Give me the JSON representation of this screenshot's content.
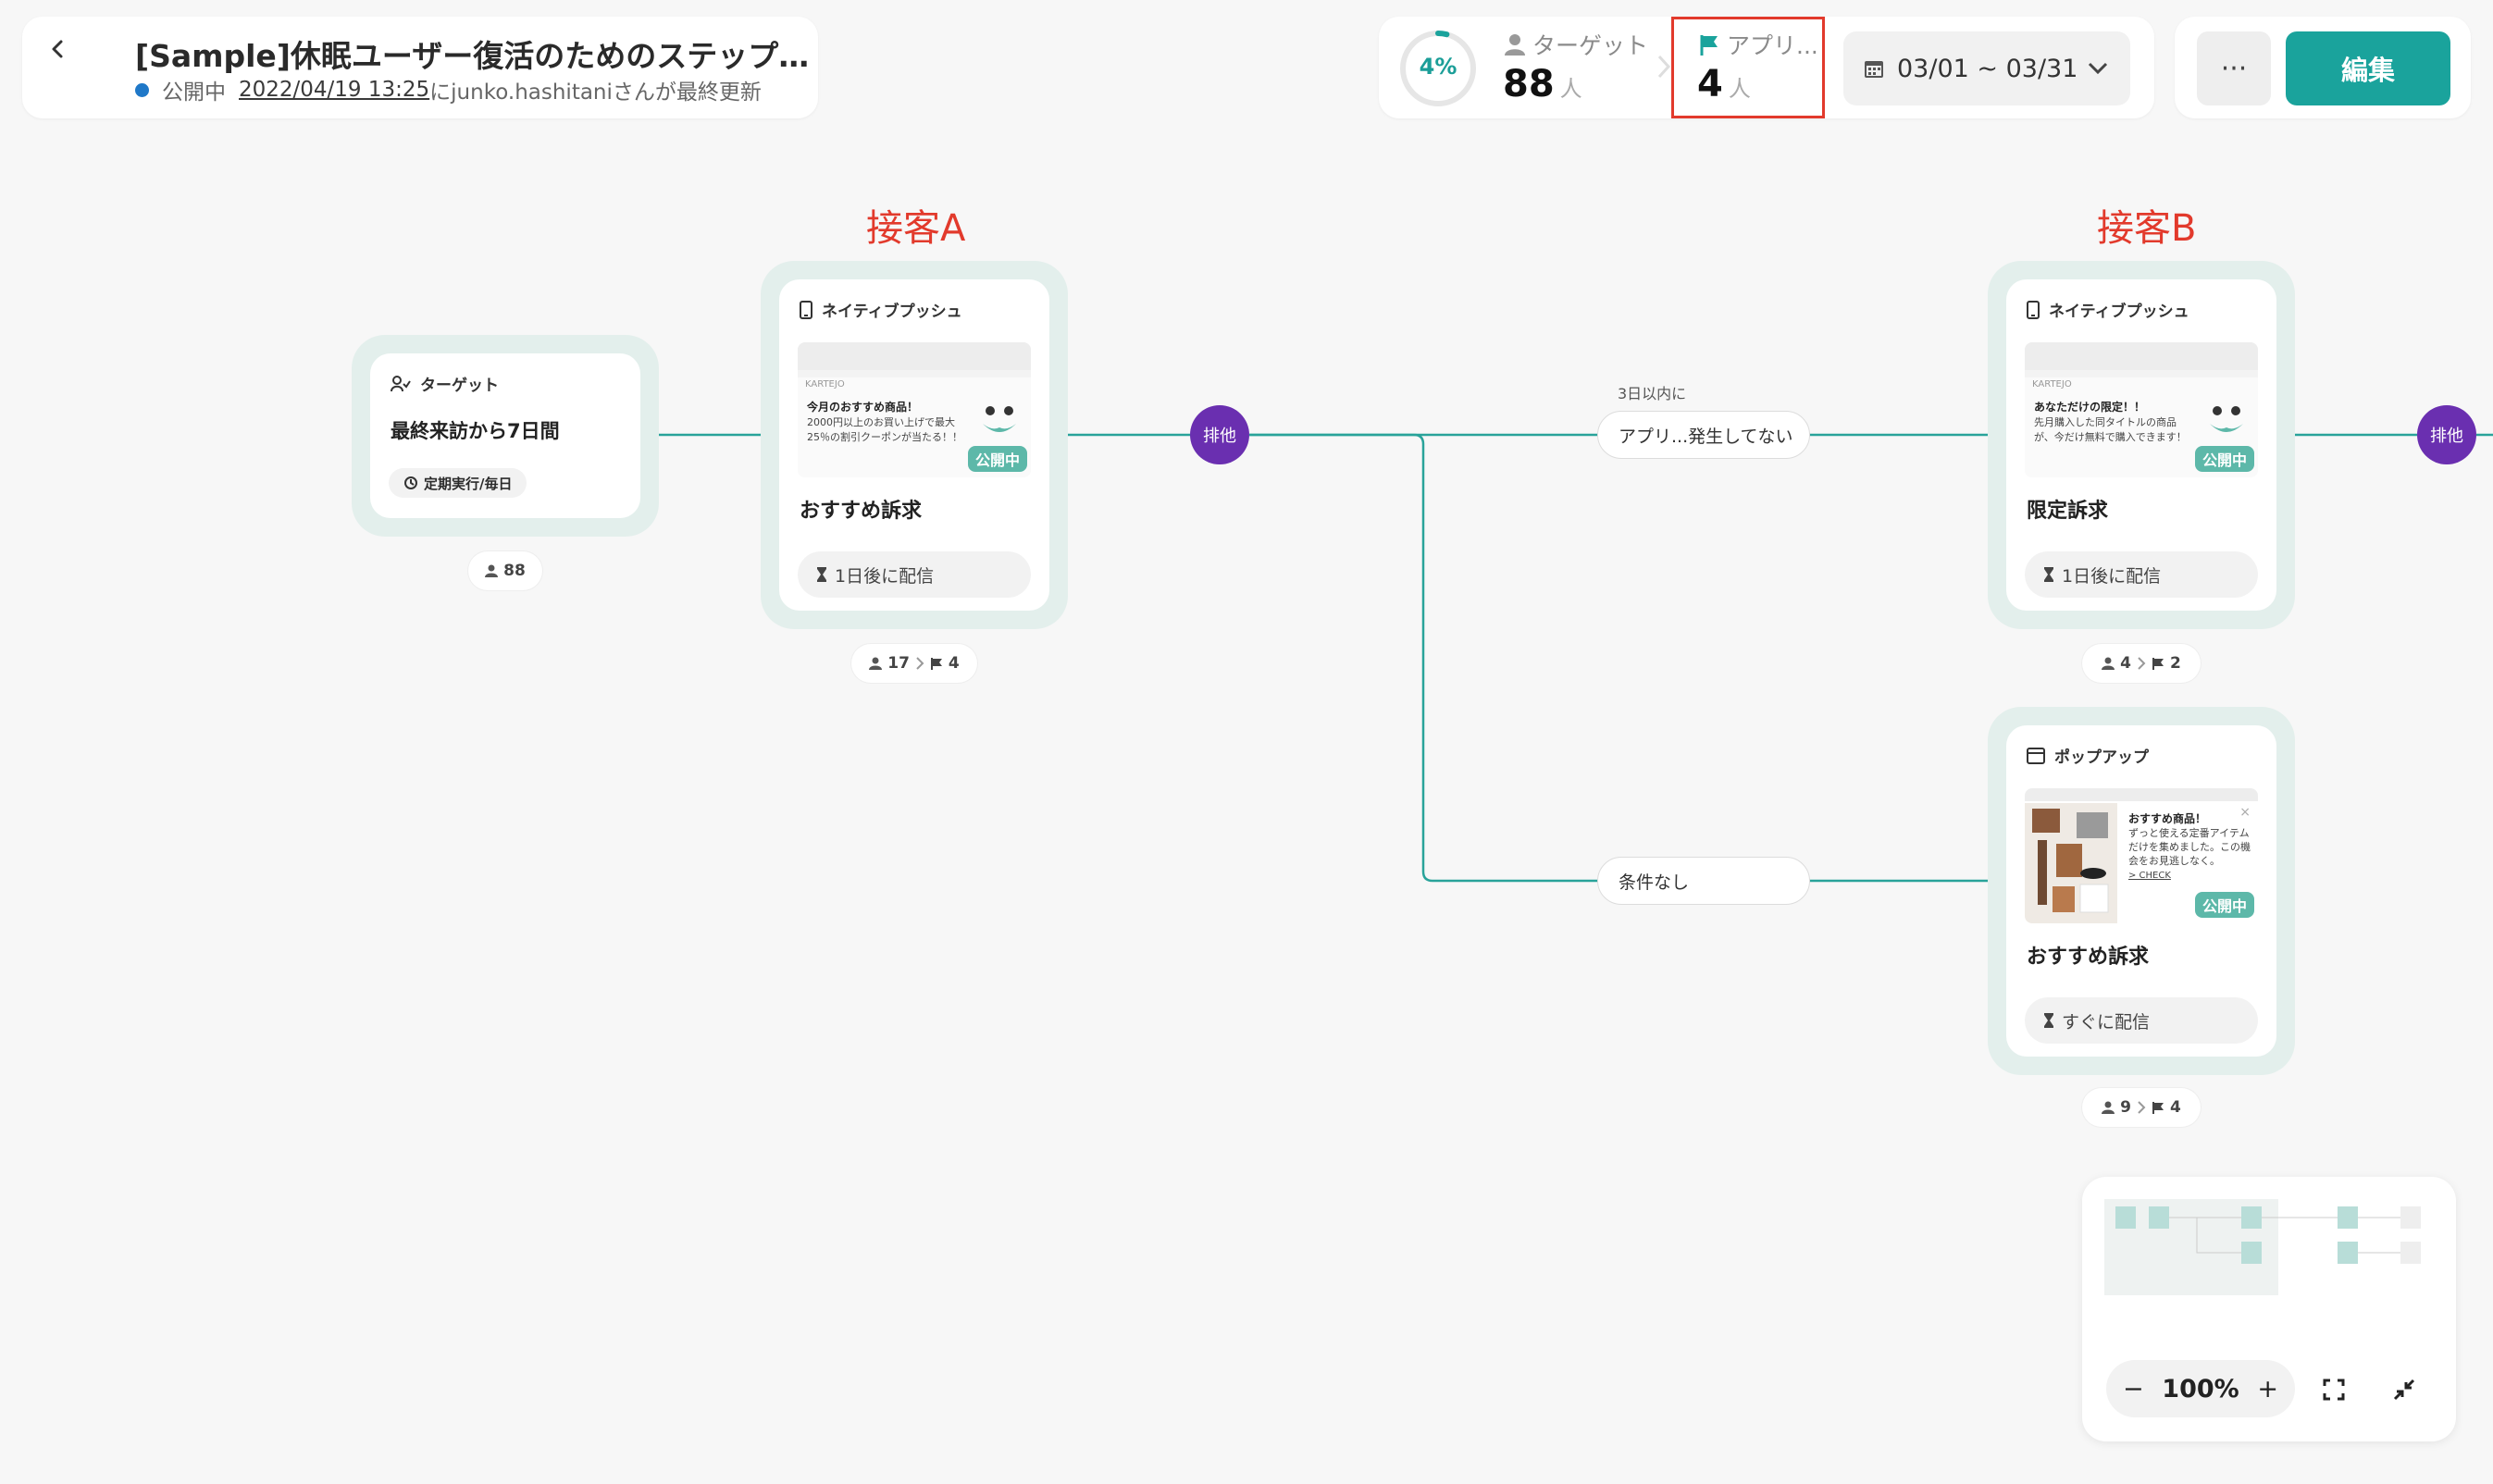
{
  "header": {
    "title": "[Sample]休眠ユーザー復活のためのステップ…",
    "status": "公開中",
    "updated_date": "2022/04/19 13:25",
    "updated_suffix": "にjunko.hashitaniさんが最終更新"
  },
  "stats": {
    "percent": "4%",
    "percent_value": 0.04,
    "target_label": "ターゲット",
    "target_value": "88",
    "app_label": "アプリ...",
    "app_value": "4",
    "unit": "人",
    "date_range": "03/01 ~ 03/31"
  },
  "actions": {
    "more": "···",
    "edit": "編集"
  },
  "annotations": {
    "a": "接客A",
    "b": "接客B"
  },
  "flow": {
    "target_node": {
      "head": "ターゲット",
      "name": "最終来訪から7日間",
      "schedule": "定期実行/毎日",
      "count": "88"
    },
    "node_a": {
      "head": "ネイティブプッシュ",
      "preview_logo": "KARTEJO",
      "preview_title": "今月のおすすめ商品！",
      "preview_body": "2000円以上のお買い上げで最大25％の割引クーポンが当たる！！",
      "badge": "公開中",
      "name": "おすすめ訴求",
      "delivery": "1日後に配信",
      "count_in": "17",
      "count_goal": "4"
    },
    "node_b": {
      "head": "ネイティブプッシュ",
      "preview_logo": "KARTEJO",
      "preview_title": "あなただけの限定！！",
      "preview_body": "先月購入した同タイトルの商品が、今だけ無料で購入できます！",
      "badge": "公開中",
      "name": "限定訴求",
      "delivery": "1日後に配信",
      "count_in": "4",
      "count_goal": "2"
    },
    "node_c": {
      "head": "ポップアップ",
      "preview_title": "おすすめ商品！",
      "preview_body": "ずっと使える定番アイテムだけを集めました。この機会をお見逃しなく。",
      "preview_link": "> CHECK",
      "badge": "公開中",
      "name": "おすすめ訴求",
      "delivery": "すぐに配信",
      "count_in": "9",
      "count_goal": "4"
    },
    "exclusive": "排他",
    "condition_1_label": "3日以内に",
    "condition_1": "アプリ...発生してない",
    "condition_2": "条件なし"
  },
  "minimap": {
    "zoom": "100%",
    "minus": "−",
    "plus": "+"
  },
  "colors": {
    "accent": "#1aa39c",
    "annotation": "#e23a2c",
    "exclusive": "#6a2fb0",
    "status_dot": "#1f78c8"
  }
}
